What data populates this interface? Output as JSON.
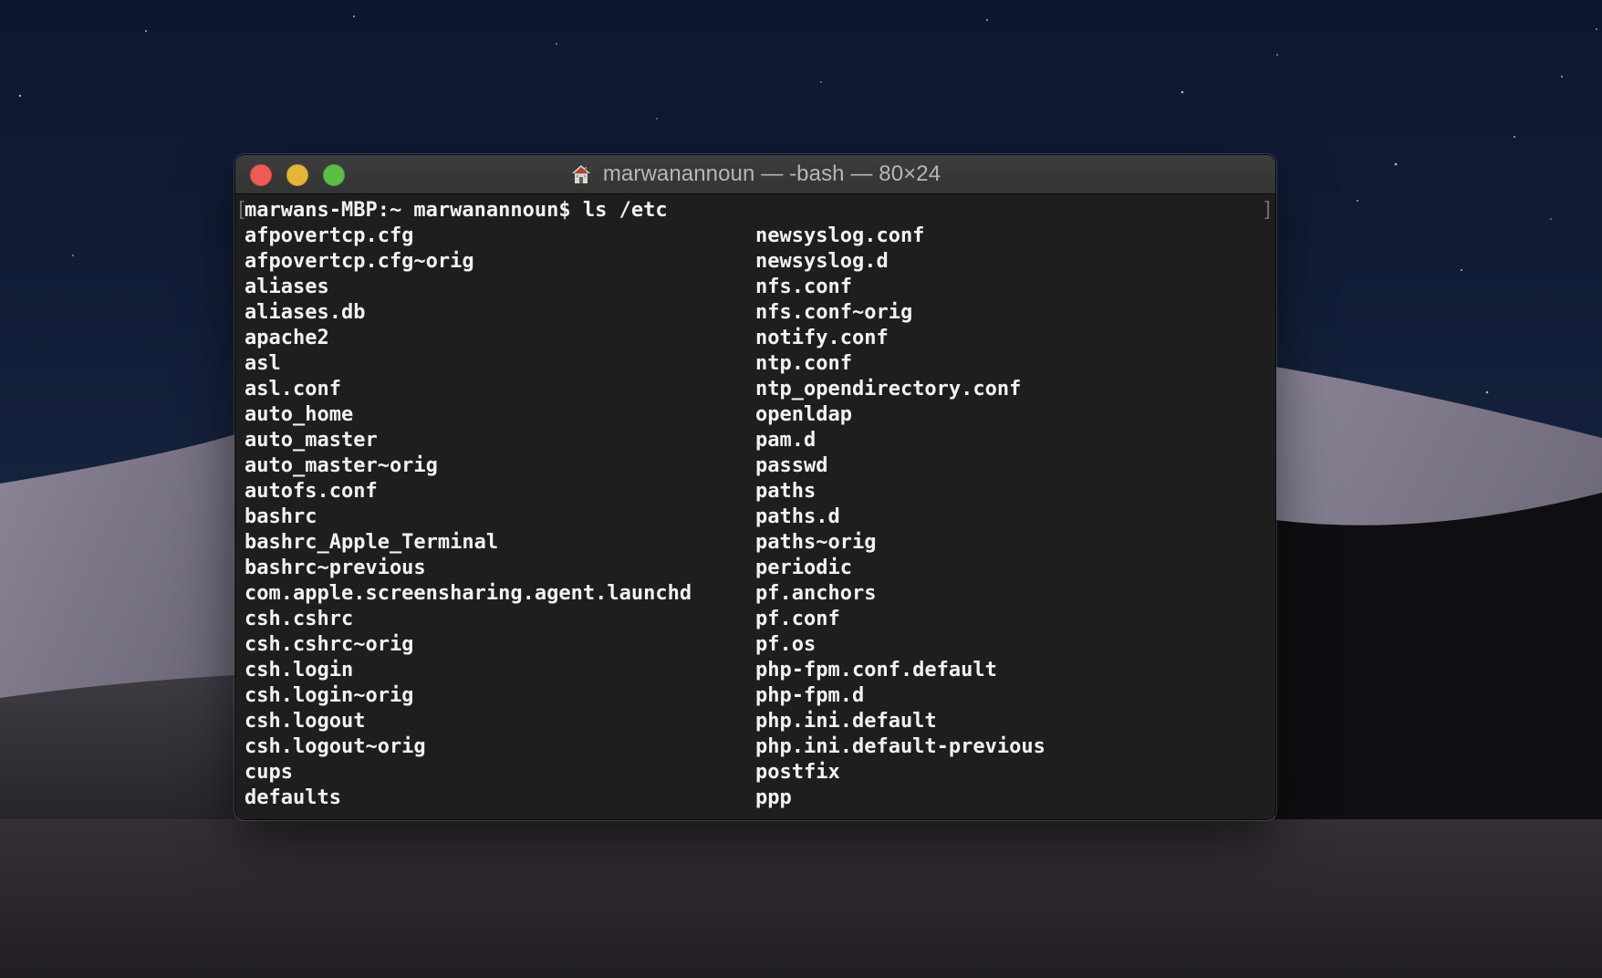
{
  "window": {
    "title": "marwanannoun — -bash — 80×24"
  },
  "terminal": {
    "prompt": "marwans-MBP:~ marwanannoun$ ls /etc",
    "left_column": [
      "afpovertcp.cfg",
      "afpovertcp.cfg~orig",
      "aliases",
      "aliases.db",
      "apache2",
      "asl",
      "asl.conf",
      "auto_home",
      "auto_master",
      "auto_master~orig",
      "autofs.conf",
      "bashrc",
      "bashrc_Apple_Terminal",
      "bashrc~previous",
      "com.apple.screensharing.agent.launchd",
      "csh.cshrc",
      "csh.cshrc~orig",
      "csh.login",
      "csh.login~orig",
      "csh.logout",
      "csh.logout~orig",
      "cups",
      "defaults"
    ],
    "right_column": [
      "newsyslog.conf",
      "newsyslog.d",
      "nfs.conf",
      "nfs.conf~orig",
      "notify.conf",
      "ntp.conf",
      "ntp_opendirectory.conf",
      "openldap",
      "pam.d",
      "passwd",
      "paths",
      "paths.d",
      "paths~orig",
      "periodic",
      "pf.anchors",
      "pf.conf",
      "pf.os",
      "php-fpm.conf.default",
      "php-fpm.d",
      "php.ini.default",
      "php.ini.default-previous",
      "postfix",
      "ppp"
    ],
    "bracket_left": "[",
    "bracket_right": "]"
  },
  "icons": {
    "title_icon": "home-icon",
    "traffic_lights": [
      "close-icon",
      "minimize-icon",
      "zoom-icon"
    ]
  },
  "colors": {
    "terminal_bg": "#1e1e1e",
    "terminal_text": "#f2f2f2",
    "close": "#ed5c56",
    "minimize": "#e3b53a",
    "zoom": "#5cbe46"
  }
}
